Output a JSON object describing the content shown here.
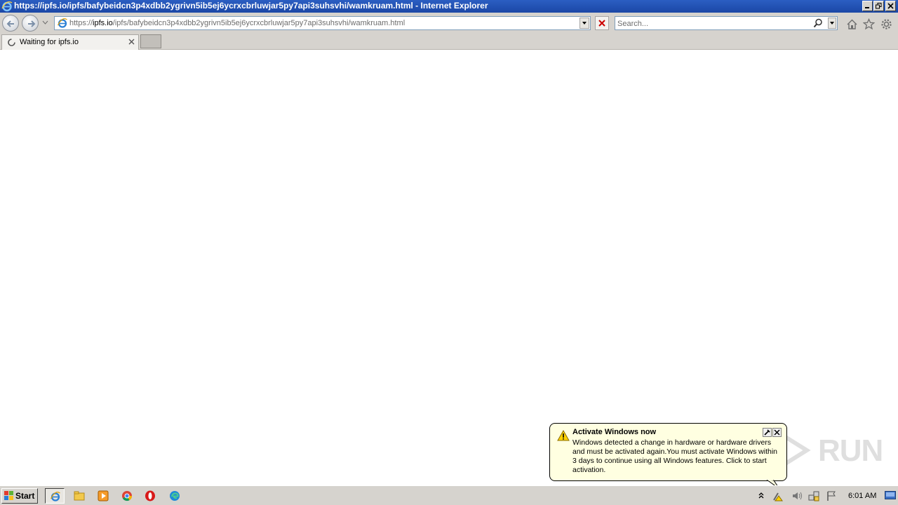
{
  "window": {
    "title": "https://ipfs.io/ipfs/bafybeidcn3p4xdbb2ygrivn5ib5ej6ycrxcbrluwjar5py7api3suhsvhi/wamkruam.html - Internet Explorer"
  },
  "address": {
    "scheme": "https://",
    "host": "ipfs.io",
    "path": "/ipfs/bafybeidcn3p4xdbb2ygrivn5ib5ej6ycrxcbrluwjar5py7api3suhsvhi/wamkruam.html"
  },
  "search": {
    "placeholder": "Search..."
  },
  "tabs": [
    {
      "label": "Waiting for ipfs.io",
      "state": "loading"
    }
  ],
  "balloon": {
    "title": "Activate Windows now",
    "body": "Windows detected a change in hardware or hardware drivers and must be activated again.You must activate Windows within 3 days to continue using all Windows features. Click to start activation."
  },
  "watermark": {
    "text": "RUN"
  },
  "taskbar": {
    "start_label": "Start",
    "apps": [
      "internet-explorer",
      "file-explorer",
      "media-player",
      "chrome",
      "opera",
      "edge"
    ],
    "clock": "6:01 AM"
  },
  "colors": {
    "titlebar": "#2b5ec2",
    "chrome_gray": "#d6d3ce",
    "balloon_bg": "#ffffe1",
    "stop_red": "#cc0000"
  }
}
